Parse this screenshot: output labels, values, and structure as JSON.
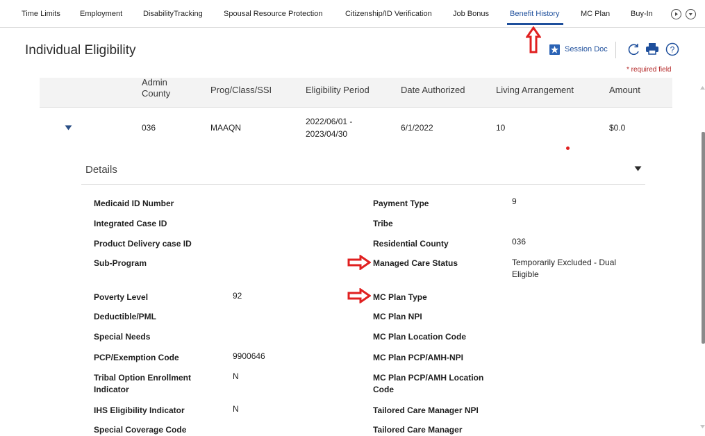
{
  "tabs": [
    {
      "label": "Time Limits"
    },
    {
      "label": "Employment"
    },
    {
      "label": "DisabilityTracking"
    },
    {
      "label": "Spousal Resource Protection"
    },
    {
      "label": "Citizenship/ID Verification"
    },
    {
      "label": "Job Bonus"
    },
    {
      "label": "Benefit History",
      "active": true
    },
    {
      "label": "MC Plan"
    },
    {
      "label": "Buy-In"
    }
  ],
  "header": {
    "title": "Individual Eligibility",
    "session_doc": "Session Doc",
    "required_note": "* required field"
  },
  "table": {
    "columns": [
      "Admin County",
      "Prog/Class/SSI",
      "Eligibility Period",
      "Date Authorized",
      "Living Arrangement",
      "Amount"
    ],
    "row": {
      "admin_county": "036",
      "prog_class": "MAAQN",
      "period_start": "2022/06/01 -",
      "period_end": "2023/04/30",
      "date_authorized": "6/1/2022",
      "living_arrangement": "10",
      "amount": "$0.0"
    }
  },
  "details": {
    "title": "Details",
    "left": [
      {
        "label": "Medicaid ID Number",
        "value": ""
      },
      {
        "label": "Integrated Case ID",
        "value": ""
      },
      {
        "label": "Product Delivery case ID",
        "value": ""
      },
      {
        "label": "Sub-Program",
        "value": ""
      },
      {
        "label": "Poverty Level",
        "value": "92"
      },
      {
        "label": "Deductible/PML",
        "value": ""
      },
      {
        "label": "Special Needs",
        "value": ""
      },
      {
        "label": "PCP/Exemption Code",
        "value": "9900646"
      },
      {
        "label": "Tribal Option Enrollment Indicator",
        "value": "N"
      },
      {
        "label": "IHS Eligibility Indicator",
        "value": "N"
      },
      {
        "label": "Special Coverage Code",
        "value": ""
      }
    ],
    "right": [
      {
        "label": "Payment Type",
        "value": "9"
      },
      {
        "label": "Tribe",
        "value": ""
      },
      {
        "label": "Residential County",
        "value": "036"
      },
      {
        "label": "Managed Care Status",
        "value": "Temporarily Excluded - Dual Eligible"
      },
      {
        "label": "MC Plan Type",
        "value": ""
      },
      {
        "label": "MC Plan NPI",
        "value": ""
      },
      {
        "label": "MC Plan Location Code",
        "value": ""
      },
      {
        "label": "MC Plan PCP/AMH-NPI",
        "value": ""
      },
      {
        "label": "MC Plan PCP/AMH Location Code",
        "value": ""
      },
      {
        "label": "Tailored Care Manager NPI",
        "value": ""
      },
      {
        "label": "Tailored Care Manager",
        "value": ""
      }
    ]
  },
  "colors": {
    "accent": "#1e4f9c",
    "annotation_red": "#e02020",
    "required_red": "#b22222",
    "header_bg": "#f3f3f3"
  },
  "icons": [
    "play-circle-icon",
    "chevron-down-circle-icon",
    "star-icon",
    "refresh-icon",
    "print-icon",
    "help-icon",
    "caret-down-icon",
    "red-arrow-up-icon",
    "red-arrow-right-icon"
  ]
}
